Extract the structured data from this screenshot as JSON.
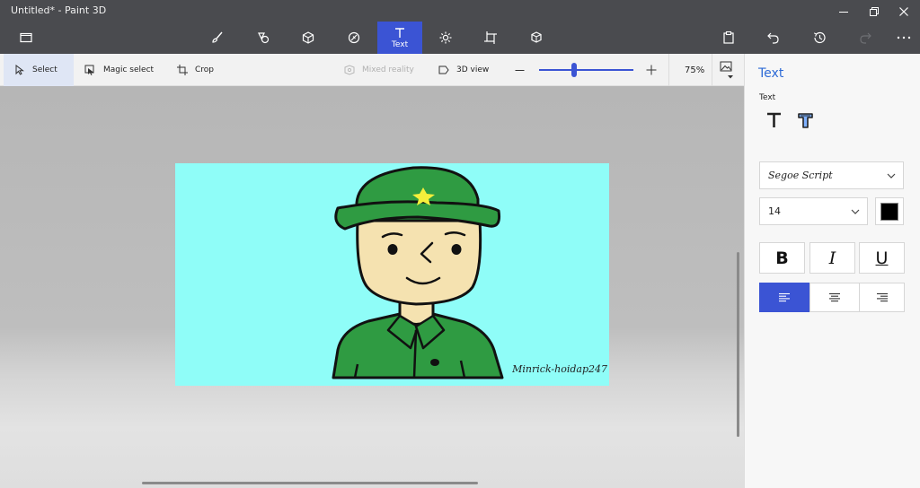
{
  "window": {
    "title": "Untitled* - Paint 3D"
  },
  "toolbar": {
    "text_label": "Text"
  },
  "subtoolbar": {
    "select_label": "Select",
    "magic_select_label": "Magic select",
    "crop_label": "Crop",
    "mixed_reality_label": "Mixed reality",
    "view_3d_label": "3D view",
    "zoom_value": "75%",
    "zoom_level": 0.37
  },
  "canvas": {
    "watermark": "Minrick-hoidap247"
  },
  "panel": {
    "title": "Text",
    "section_label": "Text",
    "font_family": "Segoe Script",
    "font_size": "14",
    "text_color": "#000000",
    "bold_label": "B",
    "italic_label": "I",
    "underline_label": "U",
    "active_alignment": "left"
  },
  "colors": {
    "accent": "#3b54d4",
    "titlebar": "#4a4b4f",
    "canvas_bg": "#8ffdf8",
    "hat_green": "#2f9b42",
    "skin": "#f5e2b0"
  }
}
